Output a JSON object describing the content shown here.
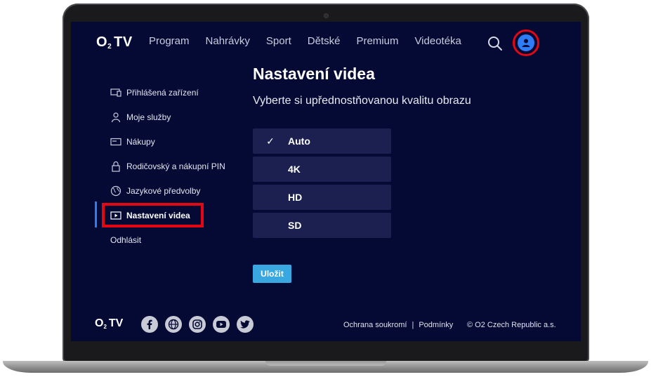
{
  "header": {
    "logo_main": "O",
    "logo_sub": "2",
    "logo_tv": "TV",
    "nav": [
      "Program",
      "Nahrávky",
      "Sport",
      "Dětské",
      "Premium",
      "Videotéka"
    ],
    "search_icon": "search-icon",
    "profile_icon": "user-profile-icon"
  },
  "sidebar": {
    "items": [
      {
        "label": "Přihlášená zařízení",
        "icon": "devices-icon"
      },
      {
        "label": "Moje služby",
        "icon": "person-icon"
      },
      {
        "label": "Nákupy",
        "icon": "card-icon"
      },
      {
        "label": "Rodičovský a nákupní PIN",
        "icon": "lock-icon"
      },
      {
        "label": "Jazykové předvolby",
        "icon": "globe-icon"
      },
      {
        "label": "Nastavení videa",
        "icon": "play-icon",
        "active": true
      },
      {
        "label": "Odhlásit"
      }
    ]
  },
  "main": {
    "title": "Nastavení videa",
    "subtitle": "Vyberte si upřednostňovanou kvalitu obrazu",
    "options": [
      {
        "label": "Auto",
        "selected": true,
        "check": "✓"
      },
      {
        "label": "4K",
        "selected": false
      },
      {
        "label": "HD",
        "selected": false
      },
      {
        "label": "SD",
        "selected": false
      }
    ],
    "save_label": "Uložit"
  },
  "footer": {
    "social": [
      "facebook-icon",
      "globe-icon",
      "instagram-icon",
      "youtube-icon",
      "twitter-icon"
    ],
    "links": [
      "Ochrana soukromí",
      "Podmínky"
    ],
    "separator": "|",
    "copyright": "© O2 Czech Republic a.s."
  },
  "colors": {
    "background": "#050a35",
    "accent": "#2e7cf6",
    "highlight": "#e30613",
    "save": "#3aa8e0"
  }
}
